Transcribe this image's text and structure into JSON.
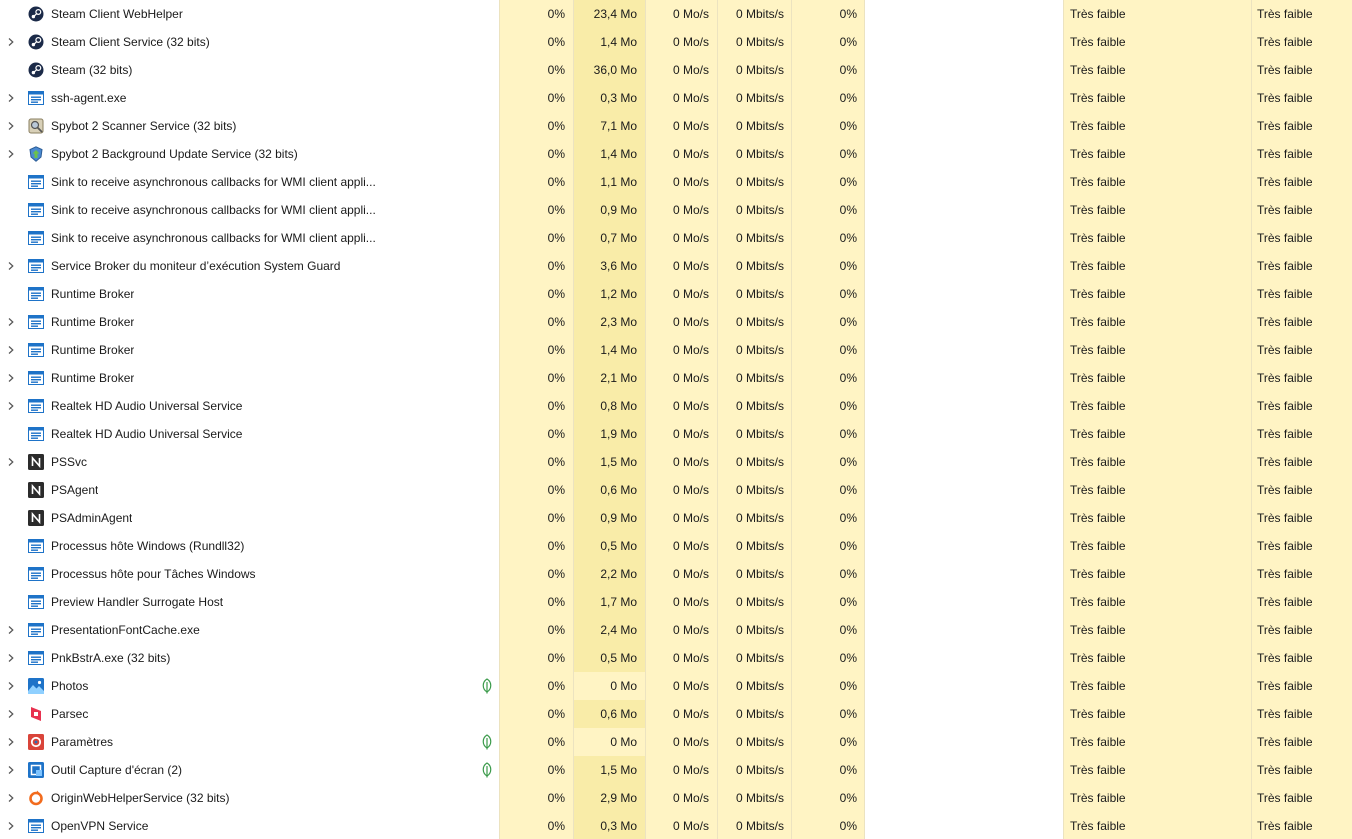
{
  "process_table": {
    "rows": [
      {
        "name": "Steam Client WebHelper",
        "icon": "steam-icon",
        "expandable": false,
        "suspended": false,
        "cpu": "0%",
        "memory": "23,4 Mo",
        "disk": "0 Mo/s",
        "network": "0 Mbits/s",
        "gpu": "0%",
        "gpu_engine": "",
        "power": "Très faible",
        "power_trend": "Très faible"
      },
      {
        "name": "Steam Client Service (32 bits)",
        "icon": "steam-icon",
        "expandable": true,
        "suspended": false,
        "cpu": "0%",
        "memory": "1,4 Mo",
        "disk": "0 Mo/s",
        "network": "0 Mbits/s",
        "gpu": "0%",
        "gpu_engine": "",
        "power": "Très faible",
        "power_trend": "Très faible"
      },
      {
        "name": "Steam (32 bits)",
        "icon": "steam-icon",
        "expandable": false,
        "suspended": false,
        "cpu": "0%",
        "memory": "36,0 Mo",
        "disk": "0 Mo/s",
        "network": "0 Mbits/s",
        "gpu": "0%",
        "gpu_engine": "",
        "power": "Très faible",
        "power_trend": "Très faible"
      },
      {
        "name": "ssh-agent.exe",
        "icon": "window-app-icon",
        "expandable": true,
        "suspended": false,
        "cpu": "0%",
        "memory": "0,3 Mo",
        "disk": "0 Mo/s",
        "network": "0 Mbits/s",
        "gpu": "0%",
        "gpu_engine": "",
        "power": "Très faible",
        "power_trend": "Très faible"
      },
      {
        "name": "Spybot 2 Scanner Service (32 bits)",
        "icon": "spybot-scanner-icon",
        "expandable": true,
        "suspended": false,
        "cpu": "0%",
        "memory": "7,1 Mo",
        "disk": "0 Mo/s",
        "network": "0 Mbits/s",
        "gpu": "0%",
        "gpu_engine": "",
        "power": "Très faible",
        "power_trend": "Très faible"
      },
      {
        "name": "Spybot 2 Background Update Service (32 bits)",
        "icon": "spybot-update-icon",
        "expandable": true,
        "suspended": false,
        "cpu": "0%",
        "memory": "1,4 Mo",
        "disk": "0 Mo/s",
        "network": "0 Mbits/s",
        "gpu": "0%",
        "gpu_engine": "",
        "power": "Très faible",
        "power_trend": "Très faible"
      },
      {
        "name": "Sink to receive asynchronous callbacks for WMI client appli...",
        "icon": "window-app-icon",
        "expandable": false,
        "suspended": false,
        "cpu": "0%",
        "memory": "1,1 Mo",
        "disk": "0 Mo/s",
        "network": "0 Mbits/s",
        "gpu": "0%",
        "gpu_engine": "",
        "power": "Très faible",
        "power_trend": "Très faible"
      },
      {
        "name": "Sink to receive asynchronous callbacks for WMI client appli...",
        "icon": "window-app-icon",
        "expandable": false,
        "suspended": false,
        "cpu": "0%",
        "memory": "0,9 Mo",
        "disk": "0 Mo/s",
        "network": "0 Mbits/s",
        "gpu": "0%",
        "gpu_engine": "",
        "power": "Très faible",
        "power_trend": "Très faible"
      },
      {
        "name": "Sink to receive asynchronous callbacks for WMI client appli...",
        "icon": "window-app-icon",
        "expandable": false,
        "suspended": false,
        "cpu": "0%",
        "memory": "0,7 Mo",
        "disk": "0 Mo/s",
        "network": "0 Mbits/s",
        "gpu": "0%",
        "gpu_engine": "",
        "power": "Très faible",
        "power_trend": "Très faible"
      },
      {
        "name": "Service Broker du moniteur d’exécution System Guard",
        "icon": "window-app-icon",
        "expandable": true,
        "suspended": false,
        "cpu": "0%",
        "memory": "3,6 Mo",
        "disk": "0 Mo/s",
        "network": "0 Mbits/s",
        "gpu": "0%",
        "gpu_engine": "",
        "power": "Très faible",
        "power_trend": "Très faible"
      },
      {
        "name": "Runtime Broker",
        "icon": "window-app-icon",
        "expandable": false,
        "suspended": false,
        "cpu": "0%",
        "memory": "1,2 Mo",
        "disk": "0 Mo/s",
        "network": "0 Mbits/s",
        "gpu": "0%",
        "gpu_engine": "",
        "power": "Très faible",
        "power_trend": "Très faible"
      },
      {
        "name": "Runtime Broker",
        "icon": "window-app-icon",
        "expandable": true,
        "suspended": false,
        "cpu": "0%",
        "memory": "2,3 Mo",
        "disk": "0 Mo/s",
        "network": "0 Mbits/s",
        "gpu": "0%",
        "gpu_engine": "",
        "power": "Très faible",
        "power_trend": "Très faible"
      },
      {
        "name": "Runtime Broker",
        "icon": "window-app-icon",
        "expandable": true,
        "suspended": false,
        "cpu": "0%",
        "memory": "1,4 Mo",
        "disk": "0 Mo/s",
        "network": "0 Mbits/s",
        "gpu": "0%",
        "gpu_engine": "",
        "power": "Très faible",
        "power_trend": "Très faible"
      },
      {
        "name": "Runtime Broker",
        "icon": "window-app-icon",
        "expandable": true,
        "suspended": false,
        "cpu": "0%",
        "memory": "2,1 Mo",
        "disk": "0 Mo/s",
        "network": "0 Mbits/s",
        "gpu": "0%",
        "gpu_engine": "",
        "power": "Très faible",
        "power_trend": "Très faible"
      },
      {
        "name": "Realtek HD Audio Universal Service",
        "icon": "window-app-icon",
        "expandable": true,
        "suspended": false,
        "cpu": "0%",
        "memory": "0,8 Mo",
        "disk": "0 Mo/s",
        "network": "0 Mbits/s",
        "gpu": "0%",
        "gpu_engine": "",
        "power": "Très faible",
        "power_trend": "Très faible"
      },
      {
        "name": "Realtek HD Audio Universal Service",
        "icon": "window-app-icon",
        "expandable": false,
        "suspended": false,
        "cpu": "0%",
        "memory": "1,9 Mo",
        "disk": "0 Mo/s",
        "network": "0 Mbits/s",
        "gpu": "0%",
        "gpu_engine": "",
        "power": "Très faible",
        "power_trend": "Très faible"
      },
      {
        "name": "PSSvc",
        "icon": "n-logo-icon",
        "expandable": true,
        "suspended": false,
        "cpu": "0%",
        "memory": "1,5 Mo",
        "disk": "0 Mo/s",
        "network": "0 Mbits/s",
        "gpu": "0%",
        "gpu_engine": "",
        "power": "Très faible",
        "power_trend": "Très faible"
      },
      {
        "name": "PSAgent",
        "icon": "n-logo-icon",
        "expandable": false,
        "suspended": false,
        "cpu": "0%",
        "memory": "0,6 Mo",
        "disk": "0 Mo/s",
        "network": "0 Mbits/s",
        "gpu": "0%",
        "gpu_engine": "",
        "power": "Très faible",
        "power_trend": "Très faible"
      },
      {
        "name": "PSAdminAgent",
        "icon": "n-logo-icon",
        "expandable": false,
        "suspended": false,
        "cpu": "0%",
        "memory": "0,9 Mo",
        "disk": "0 Mo/s",
        "network": "0 Mbits/s",
        "gpu": "0%",
        "gpu_engine": "",
        "power": "Très faible",
        "power_trend": "Très faible"
      },
      {
        "name": "Processus hôte Windows (Rundll32)",
        "icon": "window-app-icon",
        "expandable": false,
        "suspended": false,
        "cpu": "0%",
        "memory": "0,5 Mo",
        "disk": "0 Mo/s",
        "network": "0 Mbits/s",
        "gpu": "0%",
        "gpu_engine": "",
        "power": "Très faible",
        "power_trend": "Très faible"
      },
      {
        "name": "Processus hôte pour Tâches Windows",
        "icon": "window-app-icon",
        "expandable": false,
        "suspended": false,
        "cpu": "0%",
        "memory": "2,2 Mo",
        "disk": "0 Mo/s",
        "network": "0 Mbits/s",
        "gpu": "0%",
        "gpu_engine": "",
        "power": "Très faible",
        "power_trend": "Très faible"
      },
      {
        "name": "Preview Handler Surrogate Host",
        "icon": "window-app-icon",
        "expandable": false,
        "suspended": false,
        "cpu": "0%",
        "memory": "1,7 Mo",
        "disk": "0 Mo/s",
        "network": "0 Mbits/s",
        "gpu": "0%",
        "gpu_engine": "",
        "power": "Très faible",
        "power_trend": "Très faible"
      },
      {
        "name": "PresentationFontCache.exe",
        "icon": "window-app-icon",
        "expandable": true,
        "suspended": false,
        "cpu": "0%",
        "memory": "2,4 Mo",
        "disk": "0 Mo/s",
        "network": "0 Mbits/s",
        "gpu": "0%",
        "gpu_engine": "",
        "power": "Très faible",
        "power_trend": "Très faible"
      },
      {
        "name": "PnkBstrA.exe (32 bits)",
        "icon": "window-app-icon",
        "expandable": true,
        "suspended": false,
        "cpu": "0%",
        "memory": "0,5 Mo",
        "disk": "0 Mo/s",
        "network": "0 Mbits/s",
        "gpu": "0%",
        "gpu_engine": "",
        "power": "Très faible",
        "power_trend": "Très faible"
      },
      {
        "name": "Photos",
        "icon": "photos-icon",
        "expandable": true,
        "suspended": true,
        "cpu": "0%",
        "memory": "0 Mo",
        "disk": "0 Mo/s",
        "network": "0 Mbits/s",
        "gpu": "0%",
        "gpu_engine": "",
        "power": "Très faible",
        "power_trend": "Très faible"
      },
      {
        "name": "Parsec",
        "icon": "parsec-icon",
        "expandable": true,
        "suspended": false,
        "cpu": "0%",
        "memory": "0,6 Mo",
        "disk": "0 Mo/s",
        "network": "0 Mbits/s",
        "gpu": "0%",
        "gpu_engine": "",
        "power": "Très faible",
        "power_trend": "Très faible"
      },
      {
        "name": "Paramètres",
        "icon": "settings-gear-icon",
        "expandable": true,
        "suspended": true,
        "cpu": "0%",
        "memory": "0 Mo",
        "disk": "0 Mo/s",
        "network": "0 Mbits/s",
        "gpu": "0%",
        "gpu_engine": "",
        "power": "Très faible",
        "power_trend": "Très faible"
      },
      {
        "name": "Outil Capture d'écran (2)",
        "icon": "snipping-tool-icon",
        "expandable": true,
        "suspended": true,
        "cpu": "0%",
        "memory": "1,5 Mo",
        "disk": "0 Mo/s",
        "network": "0 Mbits/s",
        "gpu": "0%",
        "gpu_engine": "",
        "power": "Très faible",
        "power_trend": "Très faible"
      },
      {
        "name": "OriginWebHelperService (32 bits)",
        "icon": "origin-icon",
        "expandable": true,
        "suspended": false,
        "cpu": "0%",
        "memory": "2,9 Mo",
        "disk": "0 Mo/s",
        "network": "0 Mbits/s",
        "gpu": "0%",
        "gpu_engine": "",
        "power": "Très faible",
        "power_trend": "Très faible"
      },
      {
        "name": "OpenVPN Service",
        "icon": "window-app-icon",
        "expandable": true,
        "suspended": false,
        "cpu": "0%",
        "memory": "0,3 Mo",
        "disk": "0 Mo/s",
        "network": "0 Mbits/s",
        "gpu": "0%",
        "gpu_engine": "",
        "power": "Très faible",
        "power_trend": "Très faible"
      }
    ]
  },
  "colors": {
    "heat_low": "#fff4c4",
    "heat_mid": "#f9eca8",
    "suspended_leaf": "#3a9a4a"
  }
}
